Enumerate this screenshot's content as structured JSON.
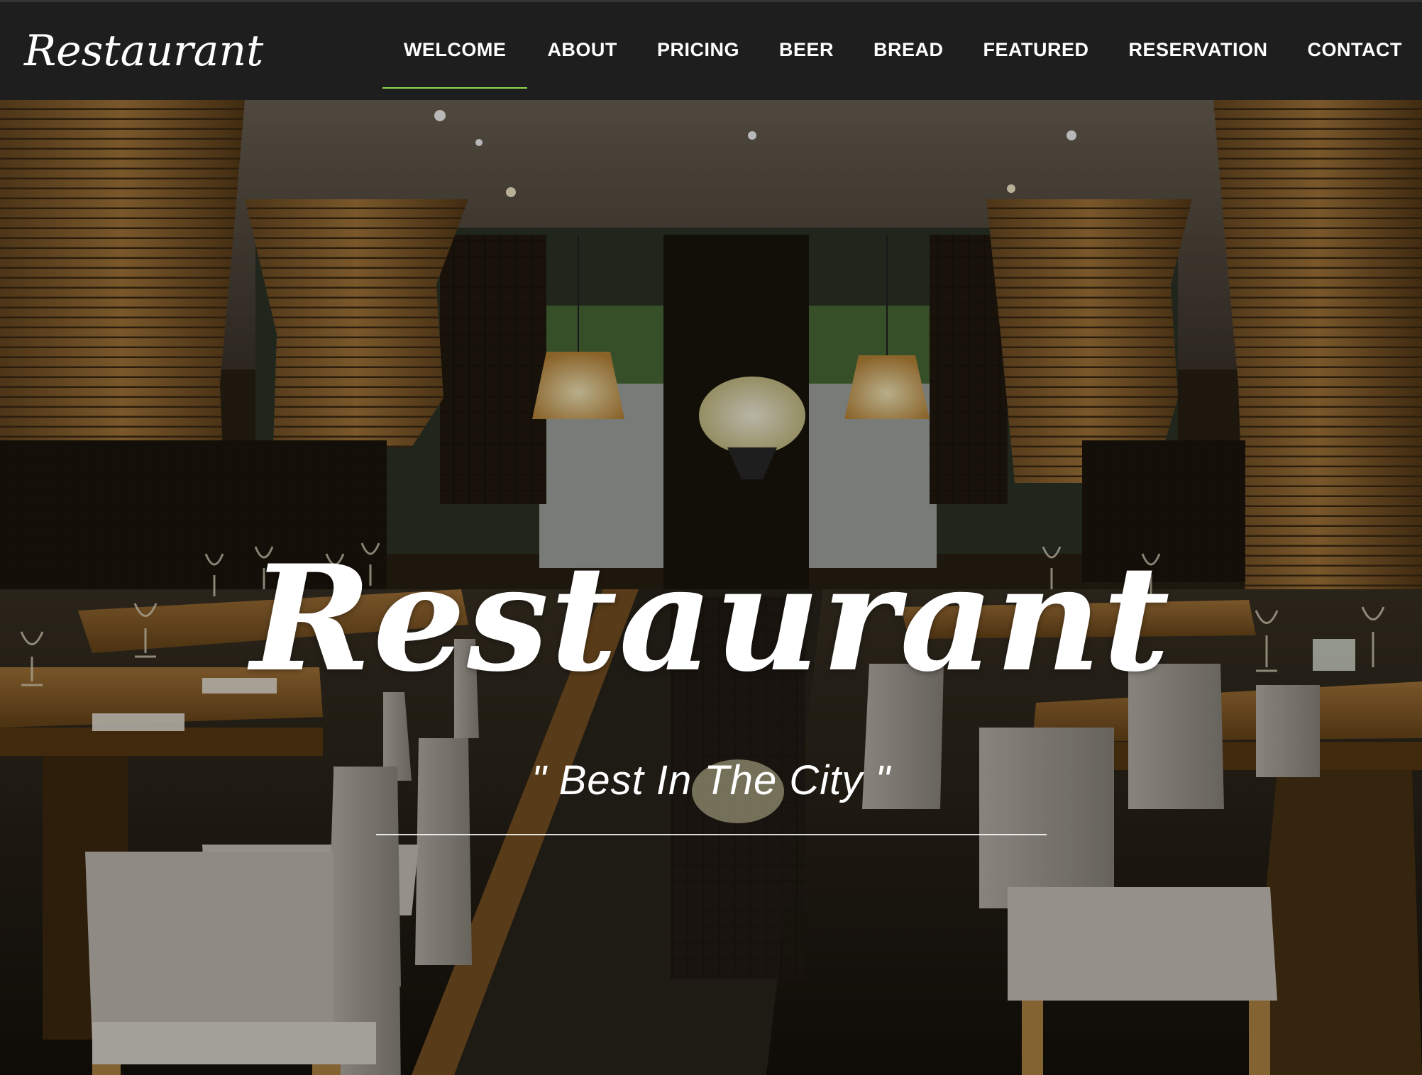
{
  "navbar": {
    "brand": "Restaurant",
    "items": [
      {
        "label": "WELCOME",
        "active": true
      },
      {
        "label": "ABOUT"
      },
      {
        "label": "PRICING"
      },
      {
        "label": "BEER"
      },
      {
        "label": "BREAD"
      },
      {
        "label": "FEATURED"
      },
      {
        "label": "RESERVATION"
      },
      {
        "label": "CONTACT"
      }
    ],
    "active_underline_color": "#8fd94f"
  },
  "hero": {
    "title": "Restaurant",
    "tagline": "\" Best In The City \"",
    "background_image": "restaurant-interior-photo"
  }
}
